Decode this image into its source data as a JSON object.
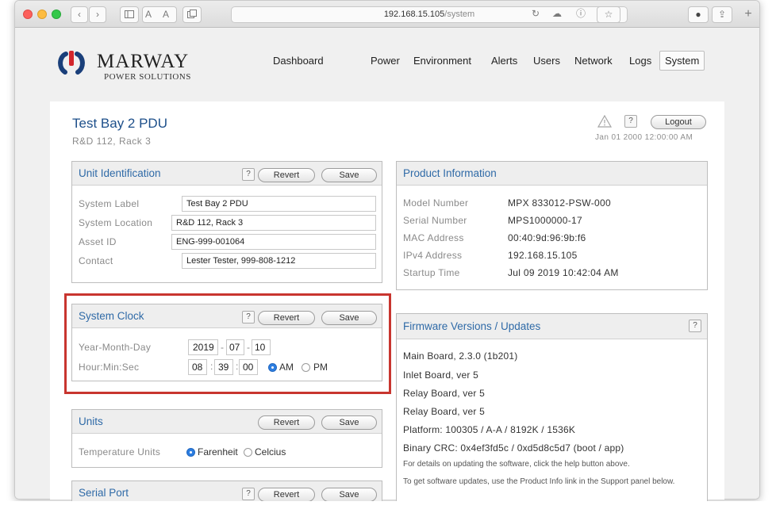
{
  "browser": {
    "url_host": "192.168.15.105",
    "url_path": "/system",
    "reader_label": "A A"
  },
  "brand": {
    "name": "MARWAY",
    "tagline": "POWER SOLUTIONS",
    "color": "#1d4f8a"
  },
  "nav": {
    "items": [
      "Dashboard",
      "Power",
      "Environment",
      "Alerts",
      "Users",
      "Network",
      "Logs",
      "System"
    ],
    "active": "System"
  },
  "page": {
    "title": "Test Bay 2 PDU",
    "subtitle": "R&D 112, Rack 3",
    "help_label": "?",
    "logout_label": "Logout",
    "datetime": "Jan 01 2000 12:00:00 AM"
  },
  "buttons": {
    "revert": "Revert",
    "save": "Save",
    "help": "?"
  },
  "unit_identification": {
    "title": "Unit Identification",
    "rows": [
      {
        "label": "System Label",
        "value": "Test Bay 2 PDU"
      },
      {
        "label": "System Location",
        "value": "R&D 112, Rack 3"
      },
      {
        "label": "Asset ID",
        "value": "ENG-999-001064"
      },
      {
        "label": "Contact",
        "value": "Lester Tester, 999-808-1212"
      }
    ]
  },
  "product_information": {
    "title": "Product Information",
    "rows": [
      {
        "label": "Model Number",
        "value": "MPX 833012-PSW-000"
      },
      {
        "label": "Serial Number",
        "value": "MPS1000000-17"
      },
      {
        "label": "MAC Address",
        "value": "00:40:9d:96:9b:f6"
      },
      {
        "label": "IPv4 Address",
        "value": "192.168.15.105"
      },
      {
        "label": "Startup Time",
        "value": "Jul 09 2019 10:42:04 AM"
      }
    ]
  },
  "system_clock": {
    "title": "System Clock",
    "date_label": "Year-Month-Day",
    "time_label": "Hour:Min:Sec",
    "year": "2019",
    "month": "07",
    "day": "10",
    "hour": "08",
    "minute": "39",
    "second": "00",
    "date_sep": "-",
    "time_sep": ":",
    "am_label": "AM",
    "pm_label": "PM",
    "selected": "AM"
  },
  "firmware": {
    "title": "Firmware Versions / Updates",
    "lines": [
      "Main Board, 2.3.0 (1b201)",
      "Inlet Board, ver 5",
      "Relay Board, ver 5",
      "Relay Board, ver 5",
      "Platform: 100305 / A-A / 8192K / 1536K",
      "Binary CRC: 0x4ef3fd5c / 0xd5d8c5d7 (boot / app)"
    ],
    "notes": [
      "For details on updating the software, click the help button above.",
      "To get software updates, use the Product Info link in the Support panel below."
    ]
  },
  "units": {
    "title": "Units",
    "label": "Temperature Units",
    "options": [
      "Farenheit",
      "Celcius"
    ],
    "selected": "Farenheit"
  },
  "serial_port": {
    "title": "Serial Port"
  },
  "colors": {
    "accent": "#2f6aa7",
    "highlight": "#c8352f",
    "radio_on": "#2c7de0"
  }
}
